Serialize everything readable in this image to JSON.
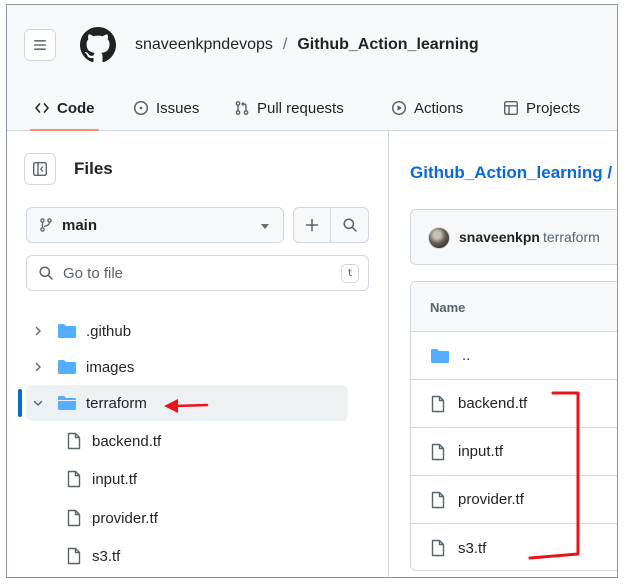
{
  "header": {
    "owner": "snaveenkpndevops",
    "separator": "/",
    "repo": "Github_Action_learning"
  },
  "tabs": [
    {
      "label": "Code",
      "icon": "code-icon",
      "active": true
    },
    {
      "label": "Issues",
      "icon": "issue-opened-icon"
    },
    {
      "label": "Pull requests",
      "icon": "git-pull-request-icon"
    },
    {
      "label": "Actions",
      "icon": "play-icon"
    },
    {
      "label": "Projects",
      "icon": "table-icon"
    }
  ],
  "sidebar": {
    "title": "Files",
    "branch": "main",
    "goto_placeholder": "Go to file",
    "goto_shortcut": "t",
    "tree": [
      {
        "label": ".github",
        "type": "folder",
        "expanded": false
      },
      {
        "label": "images",
        "type": "folder",
        "expanded": false
      },
      {
        "label": "terraform",
        "type": "folder",
        "expanded": true,
        "selected": true
      },
      {
        "label": "backend.tf",
        "type": "file"
      },
      {
        "label": "input.tf",
        "type": "file"
      },
      {
        "label": "provider.tf",
        "type": "file"
      },
      {
        "label": "s3.tf",
        "type": "file"
      }
    ]
  },
  "main": {
    "breadcrumb": "Github_Action_learning /",
    "commit_author": "snaveenkpn",
    "commit_message": "terraform",
    "table_header": "Name",
    "rows": [
      {
        "label": "..",
        "type": "folder"
      },
      {
        "label": "backend.tf",
        "type": "file"
      },
      {
        "label": "input.tf",
        "type": "file"
      },
      {
        "label": "provider.tf",
        "type": "file"
      },
      {
        "label": "s3.tf",
        "type": "file"
      }
    ]
  },
  "colors": {
    "folder": "#54aeff",
    "link": "#0969da",
    "annotation": "#e8131b",
    "tab_underline": "#fd8c73"
  }
}
